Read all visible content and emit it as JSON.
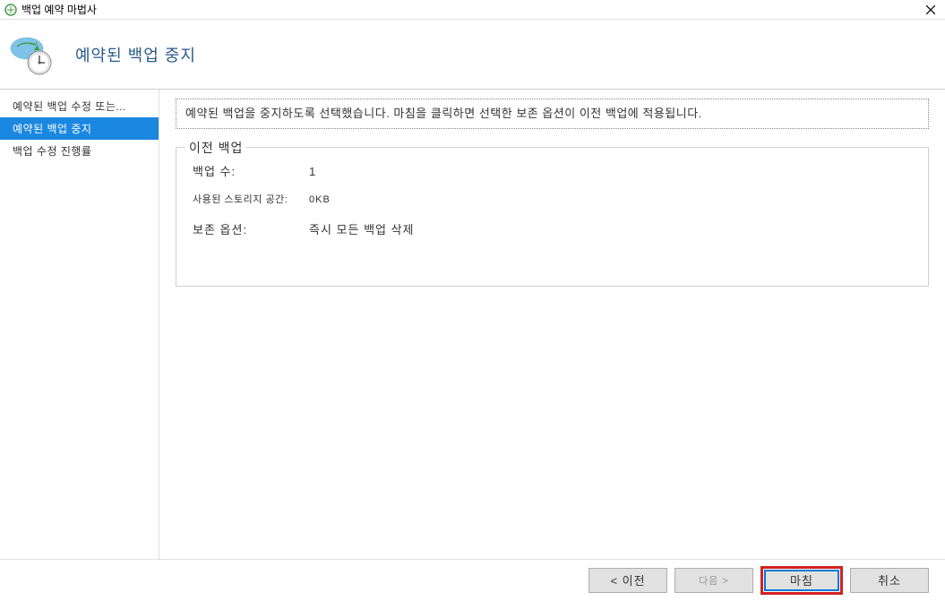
{
  "window": {
    "title": "백업 예약 마법사"
  },
  "header": {
    "title": "예약된 백업 중지"
  },
  "sidebar": {
    "items": [
      {
        "label": "예약된 백업 수정 또는...",
        "active": false
      },
      {
        "label": "예약된 백업 중지",
        "active": true
      },
      {
        "label": "백업 수정 진행률",
        "active": false
      }
    ]
  },
  "main": {
    "info_text": "예약된 백업을 중지하도록 선택했습니다. 마침을 클릭하면 선택한 보존 옵션이 이전 백업에 적용됩니다.",
    "fieldset": {
      "legend": "이전 백업",
      "rows": [
        {
          "label": "백업 수:",
          "value": "1",
          "small": false
        },
        {
          "label": "사용된 스토리지 공간:",
          "value": "0KB",
          "small": true
        },
        {
          "label": "보존 옵션:",
          "value": "즉시 모든 백업 삭제",
          "small": false
        }
      ]
    }
  },
  "footer": {
    "back": "< 이전",
    "next": "다음 >",
    "finish": "마침",
    "cancel": "취소"
  }
}
